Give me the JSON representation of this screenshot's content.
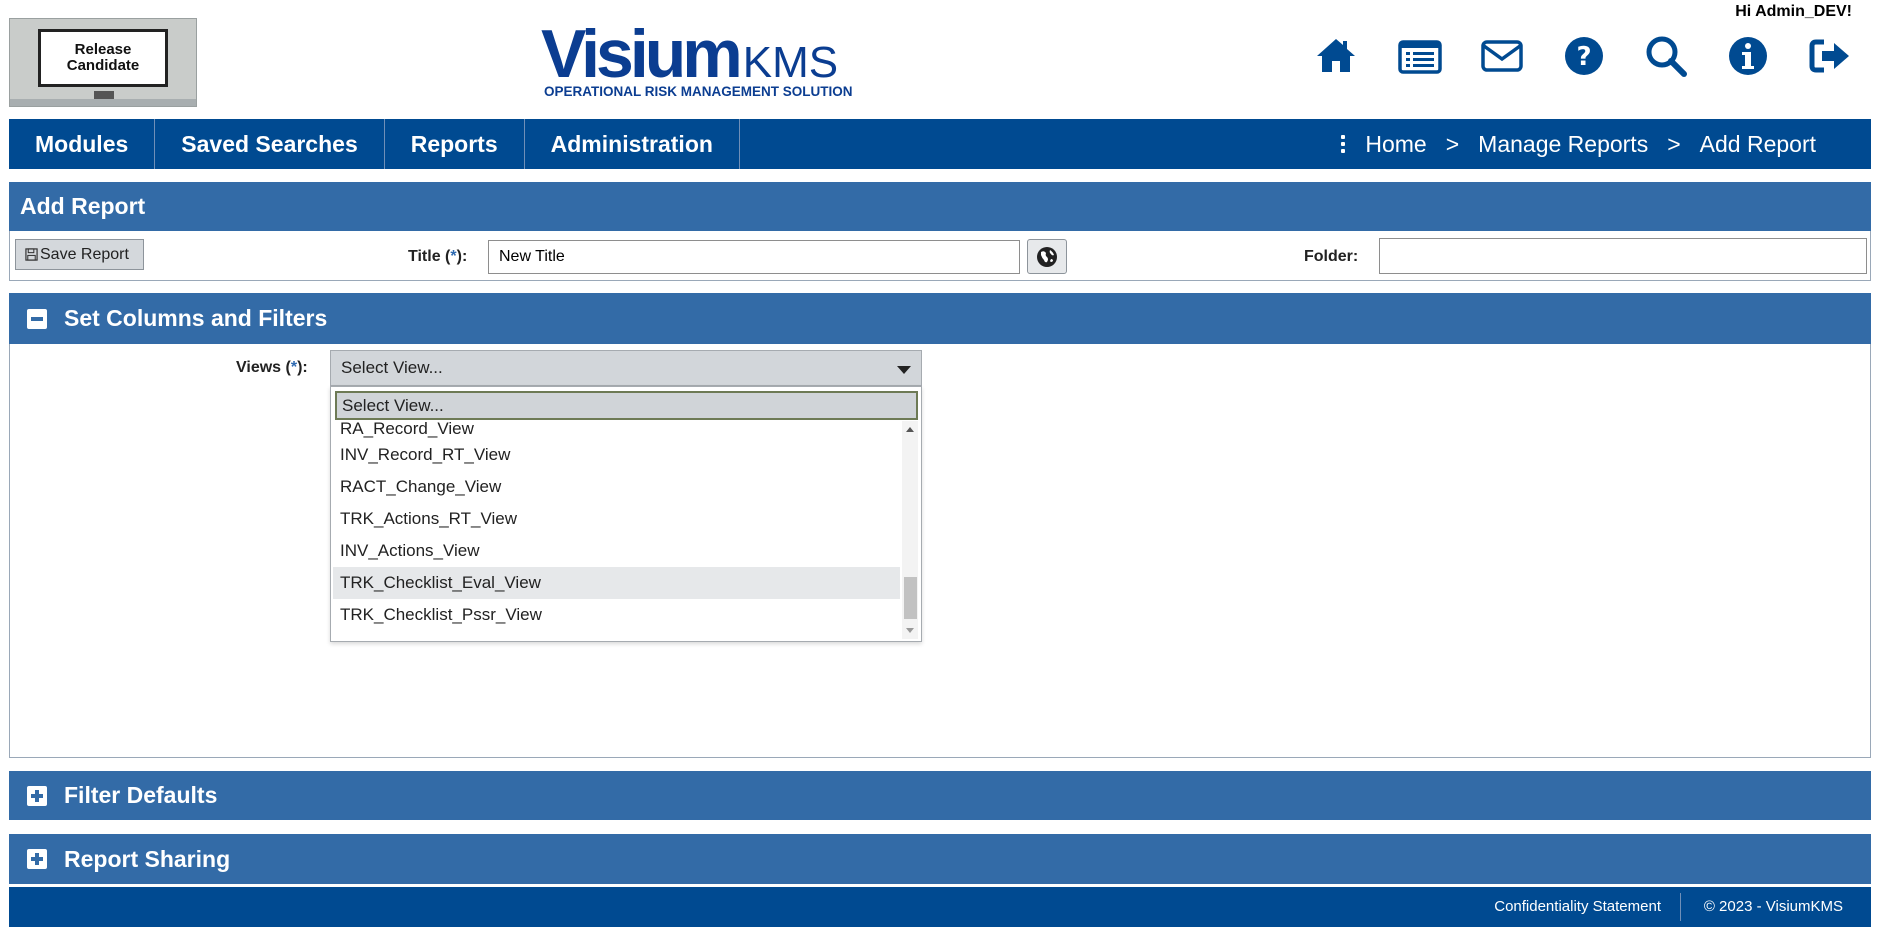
{
  "header": {
    "badge_text": "Release Candidate",
    "logo": {
      "word": "Visium",
      "suffix": "KMS",
      "tagline": "OPERATIONAL RISK MANAGEMENT SOLUTION"
    },
    "greeting": "Hi Admin_DEV!",
    "icons": [
      "home-icon",
      "list-icon",
      "mail-icon",
      "help-icon",
      "search-icon",
      "info-icon",
      "logout-icon"
    ]
  },
  "nav": {
    "items": [
      "Modules",
      "Saved Searches",
      "Reports",
      "Administration"
    ],
    "breadcrumb": [
      "Home",
      "Manage Reports",
      "Add Report"
    ],
    "separator": ">"
  },
  "add_report": {
    "heading": "Add Report",
    "save_label": "Save Report",
    "title_label": "Title (",
    "title_req": "*",
    "title_label_end": "):",
    "title_value": "New Title",
    "folder_label": "Folder:",
    "folder_value": ""
  },
  "set_columns": {
    "heading": "Set Columns and Filters",
    "views_label": "Views (",
    "views_req": "*",
    "views_label_end": "):",
    "selected": "Select View...",
    "search_text": "Select View...",
    "options": [
      "RA_Record_View",
      "INV_Record_RT_View",
      "RACT_Change_View",
      "TRK_Actions_RT_View",
      "INV_Actions_View",
      "TRK_Checklist_Eval_View",
      "TRK_Checklist_Pssr_View"
    ],
    "hovered_option": "TRK_Checklist_Eval_View"
  },
  "filter_defaults": {
    "heading": "Filter Defaults"
  },
  "report_sharing": {
    "heading": "Report Sharing"
  },
  "footer": {
    "confidentiality": "Confidentiality Statement",
    "copyright": "© 2023 - VisiumKMS"
  },
  "colors": {
    "nav": "#004a91",
    "panel_header": "#336ba7",
    "brand": "#0b3d91"
  }
}
